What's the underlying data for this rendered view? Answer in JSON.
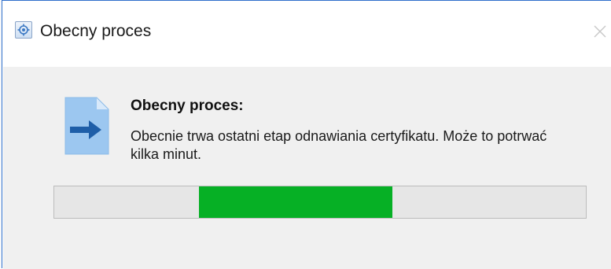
{
  "window": {
    "title": "Obecny proces"
  },
  "content": {
    "heading": "Obecny proces:",
    "message": "Obecnie trwa ostatni etap odnawiania certyfikatu. Może to potrwać kilka minut."
  },
  "progress": {
    "mode": "indeterminate-marquee",
    "fill_color": "#06b025",
    "track_color": "#e6e6e6"
  },
  "icons": {
    "app": "settings-app-icon",
    "close": "close-icon",
    "document": "document-arrow-icon"
  }
}
